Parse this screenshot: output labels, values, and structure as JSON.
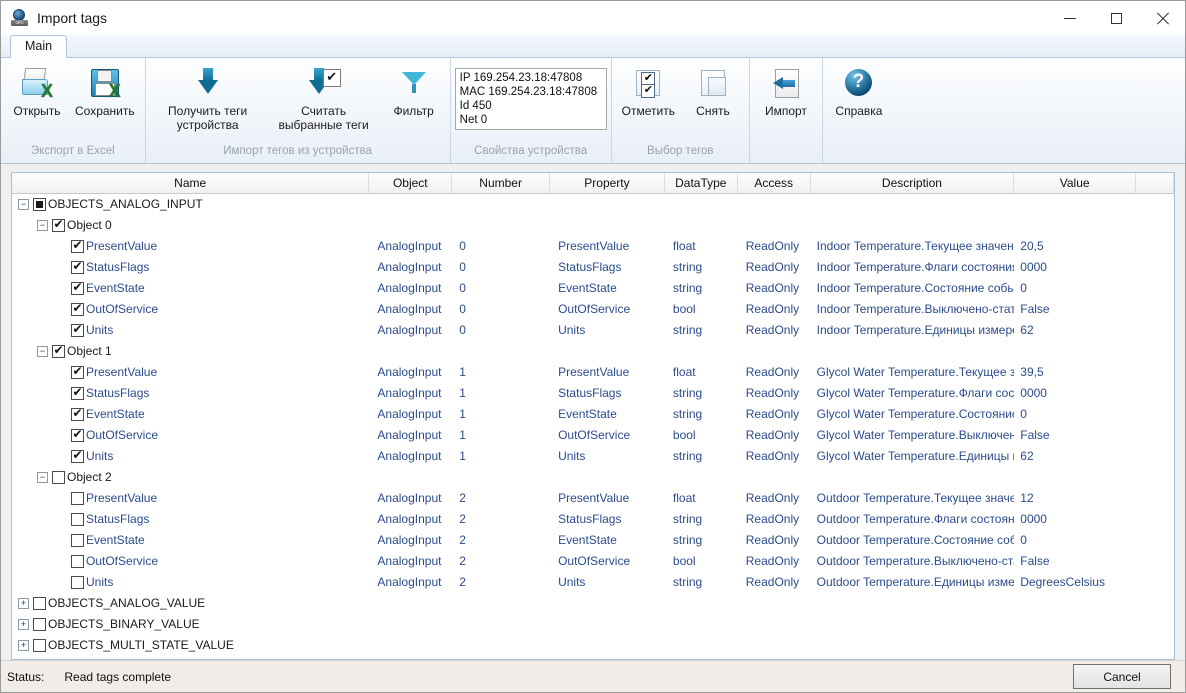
{
  "window": {
    "title": "Import tags",
    "app_icon": "opc-globe-icon",
    "minimize": "–",
    "maximize": "□",
    "close": "✕"
  },
  "ribbon": {
    "tabs": [
      {
        "label": "Main"
      }
    ],
    "groups": [
      {
        "title": "Экспорт в Excel",
        "buttons": [
          {
            "label": "Открыть",
            "icon": "open-excel-icon"
          },
          {
            "label": "Сохранить",
            "icon": "save-excel-icon"
          }
        ]
      },
      {
        "title": "Импорт тегов из устройства",
        "buttons": [
          {
            "label": "Получить теги\nустройства",
            "icon": "download-arrow-icon"
          },
          {
            "label": "Считать\nвыбранные теги",
            "icon": "download-checked-icon"
          },
          {
            "label": "Фильтр",
            "icon": "funnel-icon"
          }
        ]
      },
      {
        "title": "Свойства устройства",
        "device": {
          "ip": "IP 169.254.23.18:47808",
          "mac": "MAC 169.254.23.18:47808",
          "id": "Id 450",
          "net": "Net 0"
        }
      },
      {
        "title": "Выбор тегов",
        "buttons": [
          {
            "label": "Отметить",
            "icon": "check-all-icon"
          },
          {
            "label": "Снять",
            "icon": "uncheck-all-icon"
          }
        ]
      },
      {
        "title": "",
        "buttons": [
          {
            "label": "Импорт",
            "icon": "import-arrow-icon"
          }
        ]
      },
      {
        "title": "",
        "buttons": [
          {
            "label": "Справка",
            "icon": "help-icon"
          }
        ]
      }
    ]
  },
  "grid": {
    "columns": [
      {
        "label": "Name"
      },
      {
        "label": "Object"
      },
      {
        "label": "Number"
      },
      {
        "label": "Property"
      },
      {
        "label": "DataType"
      },
      {
        "label": "Access"
      },
      {
        "label": "Description"
      },
      {
        "label": "Value"
      },
      {
        "label": ""
      }
    ],
    "rows": [
      {
        "indent": 0,
        "toggle": "minus",
        "check": "indet",
        "name": "OBJECTS_ANALOG_INPUT",
        "name_dark": true,
        "object": "",
        "number": "",
        "property": "",
        "datatype": "",
        "access": "",
        "description": "",
        "value": ""
      },
      {
        "indent": 1,
        "toggle": "minus",
        "check": "checked",
        "name": "Object 0",
        "name_dark": true,
        "object": "",
        "number": "",
        "property": "",
        "datatype": "",
        "access": "",
        "description": "",
        "value": ""
      },
      {
        "indent": 2,
        "toggle": "none",
        "check": "checked",
        "name": "PresentValue",
        "object": "AnalogInput",
        "number": "0",
        "property": "PresentValue",
        "datatype": "float",
        "access": "ReadOnly",
        "description": "Indoor Temperature.Текущее значение",
        "value": "20,5"
      },
      {
        "indent": 2,
        "toggle": "none",
        "check": "checked",
        "name": "StatusFlags",
        "object": "AnalogInput",
        "number": "0",
        "property": "StatusFlags",
        "datatype": "string",
        "access": "ReadOnly",
        "description": "Indoor Temperature.Флаги состояния",
        "value": "0000"
      },
      {
        "indent": 2,
        "toggle": "none",
        "check": "checked",
        "name": "EventState",
        "object": "AnalogInput",
        "number": "0",
        "property": "EventState",
        "datatype": "string",
        "access": "ReadOnly",
        "description": "Indoor Temperature.Состояние события",
        "value": "0"
      },
      {
        "indent": 2,
        "toggle": "none",
        "check": "checked",
        "name": "OutOfService",
        "object": "AnalogInput",
        "number": "0",
        "property": "OutOfService",
        "datatype": "bool",
        "access": "ReadOnly",
        "description": "Indoor Temperature.Выключено-статус",
        "value": "False"
      },
      {
        "indent": 2,
        "toggle": "none",
        "check": "checked",
        "name": "Units",
        "object": "AnalogInput",
        "number": "0",
        "property": "Units",
        "datatype": "string",
        "access": "ReadOnly",
        "description": "Indoor Temperature.Единицы измерения",
        "value": "62"
      },
      {
        "indent": 1,
        "toggle": "minus",
        "check": "checked",
        "name": "Object 1",
        "name_dark": true,
        "object": "",
        "number": "",
        "property": "",
        "datatype": "",
        "access": "",
        "description": "",
        "value": ""
      },
      {
        "indent": 2,
        "toggle": "none",
        "check": "checked",
        "name": "PresentValue",
        "object": "AnalogInput",
        "number": "1",
        "property": "PresentValue",
        "datatype": "float",
        "access": "ReadOnly",
        "description": "Glycol Water Temperature.Текущее значение",
        "value": "39,5"
      },
      {
        "indent": 2,
        "toggle": "none",
        "check": "checked",
        "name": "StatusFlags",
        "object": "AnalogInput",
        "number": "1",
        "property": "StatusFlags",
        "datatype": "string",
        "access": "ReadOnly",
        "description": "Glycol Water Temperature.Флаги состояния",
        "value": "0000"
      },
      {
        "indent": 2,
        "toggle": "none",
        "check": "checked",
        "name": "EventState",
        "object": "AnalogInput",
        "number": "1",
        "property": "EventState",
        "datatype": "string",
        "access": "ReadOnly",
        "description": "Glycol Water Temperature.Состояние события",
        "value": "0"
      },
      {
        "indent": 2,
        "toggle": "none",
        "check": "checked",
        "name": "OutOfService",
        "object": "AnalogInput",
        "number": "1",
        "property": "OutOfService",
        "datatype": "bool",
        "access": "ReadOnly",
        "description": "Glycol Water Temperature.Выключено-статус",
        "value": "False"
      },
      {
        "indent": 2,
        "toggle": "none",
        "check": "checked",
        "name": "Units",
        "object": "AnalogInput",
        "number": "1",
        "property": "Units",
        "datatype": "string",
        "access": "ReadOnly",
        "description": "Glycol Water Temperature.Единицы измерения",
        "value": "62"
      },
      {
        "indent": 1,
        "toggle": "minus",
        "check": "empty",
        "name": "Object 2",
        "name_dark": true,
        "object": "",
        "number": "",
        "property": "",
        "datatype": "",
        "access": "",
        "description": "",
        "value": ""
      },
      {
        "indent": 2,
        "toggle": "none",
        "check": "empty",
        "name": "PresentValue",
        "object": "AnalogInput",
        "number": "2",
        "property": "PresentValue",
        "datatype": "float",
        "access": "ReadOnly",
        "description": "Outdoor Temperature.Текущее значение",
        "value": "12"
      },
      {
        "indent": 2,
        "toggle": "none",
        "check": "empty",
        "name": "StatusFlags",
        "object": "AnalogInput",
        "number": "2",
        "property": "StatusFlags",
        "datatype": "string",
        "access": "ReadOnly",
        "description": "Outdoor Temperature.Флаги состояния",
        "value": "0000"
      },
      {
        "indent": 2,
        "toggle": "none",
        "check": "empty",
        "name": "EventState",
        "object": "AnalogInput",
        "number": "2",
        "property": "EventState",
        "datatype": "string",
        "access": "ReadOnly",
        "description": "Outdoor Temperature.Состояние события",
        "value": "0"
      },
      {
        "indent": 2,
        "toggle": "none",
        "check": "empty",
        "name": "OutOfService",
        "object": "AnalogInput",
        "number": "2",
        "property": "OutOfService",
        "datatype": "bool",
        "access": "ReadOnly",
        "description": "Outdoor Temperature.Выключено-статус",
        "value": "False"
      },
      {
        "indent": 2,
        "toggle": "none",
        "check": "empty",
        "name": "Units",
        "object": "AnalogInput",
        "number": "2",
        "property": "Units",
        "datatype": "string",
        "access": "ReadOnly",
        "description": "Outdoor Temperature.Единицы измерения",
        "value": "DegreesCelsius"
      },
      {
        "indent": 0,
        "toggle": "plus",
        "check": "empty",
        "name": "OBJECTS_ANALOG_VALUE",
        "name_dark": true,
        "object": "",
        "number": "",
        "property": "",
        "datatype": "",
        "access": "",
        "description": "",
        "value": ""
      },
      {
        "indent": 0,
        "toggle": "plus",
        "check": "empty",
        "name": "OBJECTS_BINARY_VALUE",
        "name_dark": true,
        "object": "",
        "number": "",
        "property": "",
        "datatype": "",
        "access": "",
        "description": "",
        "value": ""
      },
      {
        "indent": 0,
        "toggle": "plus",
        "check": "empty",
        "name": "OBJECTS_MULTI_STATE_VALUE",
        "name_dark": true,
        "object": "",
        "number": "",
        "property": "",
        "datatype": "",
        "access": "",
        "description": "",
        "value": ""
      }
    ]
  },
  "statusbar": {
    "label": "Status:",
    "text": "Read tags complete",
    "cancel_label": "Cancel"
  },
  "colors": {
    "grid_text": "#2b4c8c",
    "accent": "#1f7fb5",
    "excel_green": "#1e7a32"
  }
}
